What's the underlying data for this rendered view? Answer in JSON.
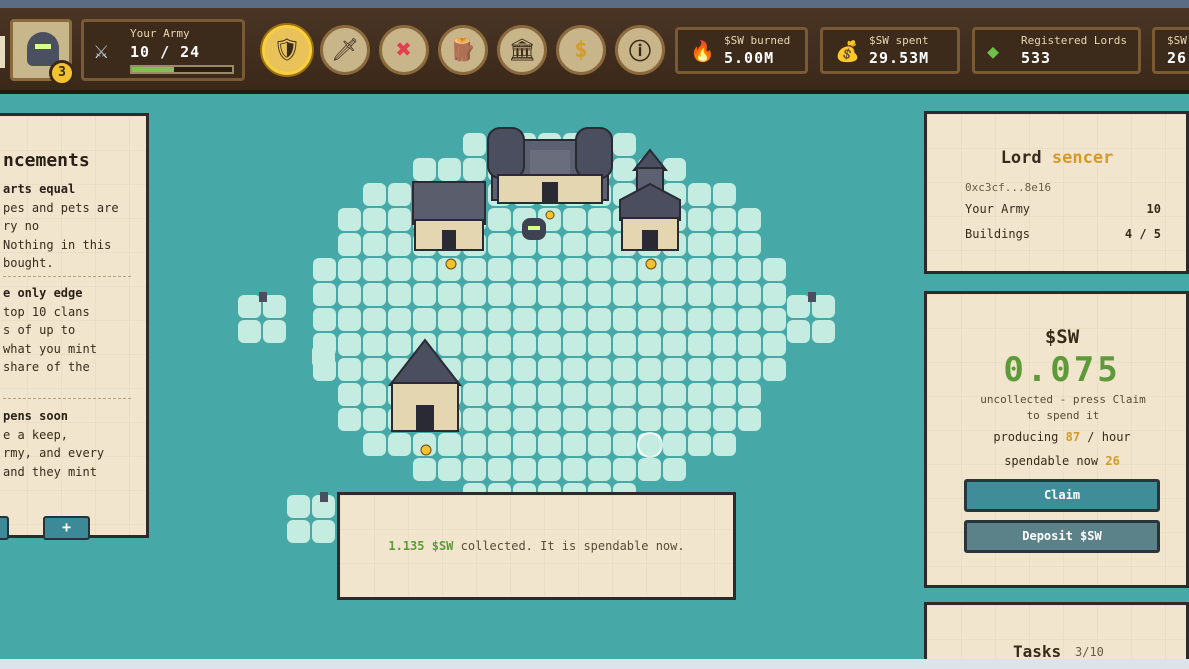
{
  "topbar": {
    "player_level": "3",
    "army": {
      "label": "Your Army",
      "value": "10 / 24",
      "progress": 0.42
    },
    "nav_icons": [
      "shield-icon",
      "sword-icon",
      "cross-icon",
      "log-icon",
      "buildings-icon",
      "coin-icon",
      "info-icon"
    ],
    "stats": [
      {
        "label": "$SW burned",
        "value": "5.00M",
        "icon": "fire-icon"
      },
      {
        "label": "$SW spent",
        "value": "29.53M",
        "icon": "money-bag-icon"
      },
      {
        "label": "Registered Lords",
        "value": "533",
        "icon": "gem-icon"
      },
      {
        "label": "$SW",
        "value": "26",
        "icon": "sw-icon"
      }
    ]
  },
  "announcements": {
    "title": "ncements",
    "items": [
      {
        "heading": "arts equal",
        "lines": [
          "pes and pets are",
          "ry no",
          "Nothing in this",
          " bought."
        ]
      },
      {
        "heading": "e only edge",
        "lines": [
          "top 10 clans",
          "s of up to",
          "what you mint",
          "share of the"
        ]
      },
      {
        "heading": "pens soon",
        "lines": [
          "e a keep,",
          "rmy, and every",
          "and they mint"
        ]
      }
    ],
    "add_label": "+"
  },
  "lord": {
    "prefix": "Lord",
    "name": "sencer",
    "address": "0xc3cf...8e16",
    "rows": [
      {
        "label": "Your Army",
        "value": "10"
      },
      {
        "label": "Buildings",
        "value": "4 / 5"
      }
    ]
  },
  "sw": {
    "title": "$SW",
    "amount": "0.075",
    "note": "uncollected - press Claim to spend it",
    "producing_label": "producing",
    "producing_value": "87",
    "producing_unit": "/ hour",
    "spendable_label": "spendable now",
    "spendable_value": "26",
    "claim_label": "Claim",
    "deposit_label": "Deposit $SW"
  },
  "tasks": {
    "title": "Tasks",
    "count": "3/10"
  },
  "message": {
    "amount": "1.135 $SW",
    "text": "collected. It is spendable now."
  },
  "colors": {
    "accent_gold": "#d49a2a",
    "sw_green": "#5e9a3a",
    "water": "#46a9a8",
    "tile": "#c5ece0"
  }
}
